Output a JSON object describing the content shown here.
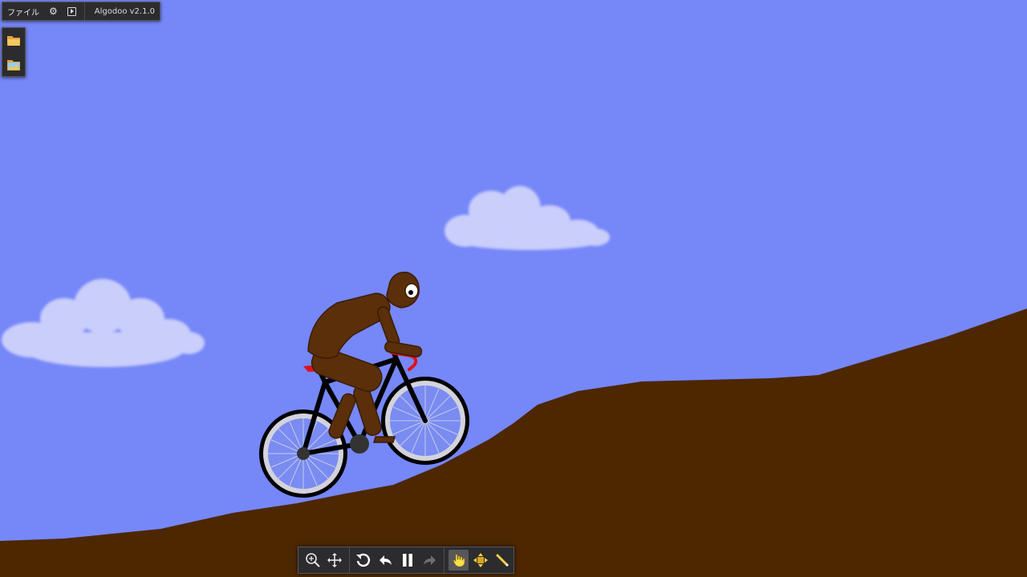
{
  "app": {
    "menu_file": "ファイル",
    "version": "Algodoo v2.1.0"
  },
  "colors": {
    "sky": "#7687f8",
    "ground": "#4d2700",
    "cloud": "#c9cefb",
    "rider": "#5a2f0a",
    "bike_frame": "#000000",
    "saddle": "#e0101a",
    "tire": "#000000",
    "rim": "#d3d3dc"
  },
  "top_menu_icons": [
    "settings-gear-icon",
    "play-window-icon"
  ],
  "side_panel": [
    "folder-icon",
    "scene-browser-icon"
  ],
  "toolbar": {
    "view_tools": [
      "zoom-icon",
      "pan-icon"
    ],
    "sim_controls": [
      "reset-icon",
      "undo-icon",
      "pause-icon",
      "redo-icon"
    ],
    "edit_tools": [
      "drag-tool-icon",
      "move-tool-icon",
      "sketch-tool-icon"
    ],
    "active_tool": "drag-tool-icon"
  }
}
